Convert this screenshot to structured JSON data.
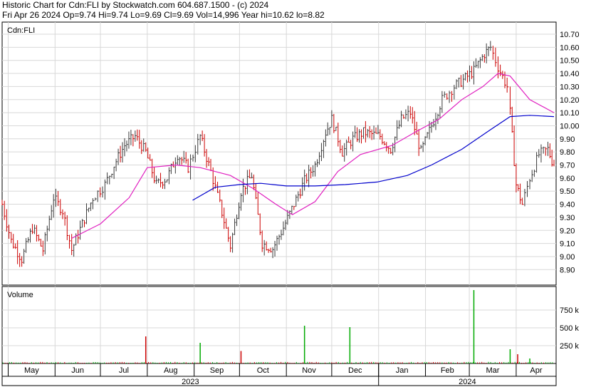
{
  "header": {
    "line1": "Historic Chart for Cdn:FLI by Stockwatch.com 604.687.1500 - (c) 2024",
    "line2": "Fri Apr 26 2024  Op=9.74  Hi=9.74  Lo=9.69  Cl=9.69  Vol=14,996  Year hi=10.62  lo=8.82"
  },
  "colors": {
    "up_bar": "#3a3a3a",
    "down_bar": "#cc0000",
    "ma_short": "#e020c0",
    "ma_long": "#0000cc",
    "grid": "#d8d8d8",
    "volume_up": "#00aa00",
    "volume_down": "#cc0000"
  },
  "chart_data": [
    {
      "type": "line",
      "panel": "price",
      "symbol_label": "Cdn:FLI",
      "ylim": [
        8.8,
        10.72
      ],
      "y_ticks": [
        "10.70",
        "10.60",
        "10.50",
        "10.40",
        "10.30",
        "10.20",
        "10.10",
        "10.00",
        "9.90",
        "9.80",
        "9.70",
        "9.60",
        "9.50",
        "9.40",
        "9.30",
        "9.20",
        "9.10",
        "9.00",
        "8.90"
      ],
      "x_month_labels": [
        "May",
        "Jun",
        "Jul",
        "Aug",
        "Sep",
        "Oct",
        "Nov",
        "Dec",
        "Jan",
        "Feb",
        "Mar",
        "Apr"
      ],
      "x_year_labels": [
        "2023",
        "2024"
      ],
      "grid": true,
      "close_anchors": [
        {
          "d": "2023-04-27",
          "c": 9.4
        },
        {
          "d": "2023-05-03",
          "c": 9.12
        },
        {
          "d": "2023-05-10",
          "c": 8.98
        },
        {
          "d": "2023-05-17",
          "c": 9.22
        },
        {
          "d": "2023-05-24",
          "c": 9.05
        },
        {
          "d": "2023-05-31",
          "c": 9.45
        },
        {
          "d": "2023-06-06",
          "c": 9.35
        },
        {
          "d": "2023-06-12",
          "c": 9.05
        },
        {
          "d": "2023-06-19",
          "c": 9.25
        },
        {
          "d": "2023-06-26",
          "c": 9.45
        },
        {
          "d": "2023-07-04",
          "c": 9.55
        },
        {
          "d": "2023-07-10",
          "c": 9.7
        },
        {
          "d": "2023-07-17",
          "c": 9.85
        },
        {
          "d": "2023-07-24",
          "c": 9.92
        },
        {
          "d": "2023-07-31",
          "c": 9.8
        },
        {
          "d": "2023-08-07",
          "c": 9.55
        },
        {
          "d": "2023-08-14",
          "c": 9.6
        },
        {
          "d": "2023-08-21",
          "c": 9.78
        },
        {
          "d": "2023-08-28",
          "c": 9.68
        },
        {
          "d": "2023-09-05",
          "c": 9.92
        },
        {
          "d": "2023-09-12",
          "c": 9.65
        },
        {
          "d": "2023-09-18",
          "c": 9.4
        },
        {
          "d": "2023-09-25",
          "c": 9.08
        },
        {
          "d": "2023-10-02",
          "c": 9.5
        },
        {
          "d": "2023-10-09",
          "c": 9.62
        },
        {
          "d": "2023-10-16",
          "c": 9.1
        },
        {
          "d": "2023-10-23",
          "c": 9.06
        },
        {
          "d": "2023-10-30",
          "c": 9.22
        },
        {
          "d": "2023-11-06",
          "c": 9.4
        },
        {
          "d": "2023-11-13",
          "c": 9.58
        },
        {
          "d": "2023-11-20",
          "c": 9.7
        },
        {
          "d": "2023-11-27",
          "c": 9.95
        },
        {
          "d": "2023-12-01",
          "c": 10.05
        },
        {
          "d": "2023-12-08",
          "c": 9.8
        },
        {
          "d": "2023-12-15",
          "c": 9.9
        },
        {
          "d": "2023-12-22",
          "c": 9.95
        },
        {
          "d": "2024-01-02",
          "c": 9.92
        },
        {
          "d": "2024-01-09",
          "c": 9.82
        },
        {
          "d": "2024-01-16",
          "c": 10.05
        },
        {
          "d": "2024-01-22",
          "c": 10.1
        },
        {
          "d": "2024-01-29",
          "c": 9.8
        },
        {
          "d": "2024-02-05",
          "c": 10.0
        },
        {
          "d": "2024-02-12",
          "c": 10.2
        },
        {
          "d": "2024-02-20",
          "c": 10.3
        },
        {
          "d": "2024-02-26",
          "c": 10.35
        },
        {
          "d": "2024-03-04",
          "c": 10.42
        },
        {
          "d": "2024-03-11",
          "c": 10.55
        },
        {
          "d": "2024-03-15",
          "c": 10.6
        },
        {
          "d": "2024-03-20",
          "c": 10.45
        },
        {
          "d": "2024-03-26",
          "c": 10.3
        },
        {
          "d": "2024-03-28",
          "c": 10.1
        },
        {
          "d": "2024-04-01",
          "c": 9.55
        },
        {
          "d": "2024-04-05",
          "c": 9.4
        },
        {
          "d": "2024-04-10",
          "c": 9.6
        },
        {
          "d": "2024-04-16",
          "c": 9.78
        },
        {
          "d": "2024-04-22",
          "c": 9.82
        },
        {
          "d": "2024-04-26",
          "c": 9.69
        }
      ],
      "series": [
        {
          "name": "short moving average",
          "color": "#e020c0",
          "points": [
            [
              "2023-06-12",
              9.14
            ],
            [
              "2023-07-01",
              9.25
            ],
            [
              "2023-07-20",
              9.45
            ],
            [
              "2023-08-01",
              9.68
            ],
            [
              "2023-08-20",
              9.7
            ],
            [
              "2023-09-05",
              9.68
            ],
            [
              "2023-09-25",
              9.62
            ],
            [
              "2023-10-10",
              9.52
            ],
            [
              "2023-10-25",
              9.4
            ],
            [
              "2023-11-05",
              9.32
            ],
            [
              "2023-11-20",
              9.42
            ],
            [
              "2023-12-05",
              9.65
            ],
            [
              "2023-12-20",
              9.78
            ],
            [
              "2024-01-10",
              9.85
            ],
            [
              "2024-01-25",
              9.95
            ],
            [
              "2024-02-10",
              10.05
            ],
            [
              "2024-02-25",
              10.2
            ],
            [
              "2024-03-10",
              10.3
            ],
            [
              "2024-03-20",
              10.4
            ],
            [
              "2024-03-28",
              10.38
            ],
            [
              "2024-04-10",
              10.2
            ],
            [
              "2024-04-26",
              10.1
            ]
          ]
        },
        {
          "name": "long moving average",
          "color": "#0000cc",
          "points": [
            [
              "2023-08-31",
              9.43
            ],
            [
              "2023-09-15",
              9.53
            ],
            [
              "2023-10-01",
              9.55
            ],
            [
              "2023-10-15",
              9.56
            ],
            [
              "2023-11-01",
              9.54
            ],
            [
              "2023-11-20",
              9.54
            ],
            [
              "2023-12-10",
              9.55
            ],
            [
              "2023-12-31",
              9.57
            ],
            [
              "2024-01-20",
              9.62
            ],
            [
              "2024-02-05",
              9.7
            ],
            [
              "2024-02-25",
              9.82
            ],
            [
              "2024-03-15",
              9.97
            ],
            [
              "2024-03-28",
              10.07
            ],
            [
              "2024-04-10",
              10.08
            ],
            [
              "2024-04-26",
              10.07
            ]
          ]
        }
      ]
    },
    {
      "type": "bar",
      "panel": "volume",
      "title": "Volume",
      "y_ticks": [
        "750 k",
        "500 k",
        "250 k"
      ],
      "ylim": [
        0,
        1050
      ],
      "unit": "thousands of shares",
      "baseline_k": 8,
      "spikes": [
        {
          "d": "2023-07-31",
          "v": 380,
          "dir": "down"
        },
        {
          "d": "2023-09-05",
          "v": 290,
          "dir": "up"
        },
        {
          "d": "2023-10-02",
          "v": 175,
          "dir": "down"
        },
        {
          "d": "2023-11-13",
          "v": 530,
          "dir": "up"
        },
        {
          "d": "2023-12-13",
          "v": 510,
          "dir": "up"
        },
        {
          "d": "2024-03-04",
          "v": 1030,
          "dir": "up"
        },
        {
          "d": "2024-03-28",
          "v": 200,
          "dir": "up"
        },
        {
          "d": "2024-04-02",
          "v": 130,
          "dir": "down"
        },
        {
          "d": "2024-04-10",
          "v": 70,
          "dir": "up"
        }
      ]
    }
  ]
}
